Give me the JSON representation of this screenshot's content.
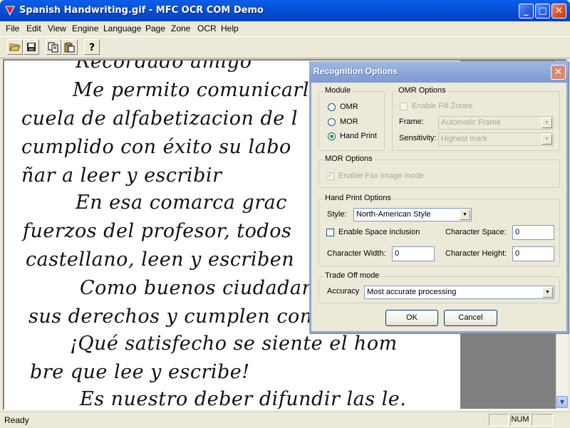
{
  "window": {
    "title": "Spanish Handwriting.gif - MFC OCR COM Demo",
    "minimize": "_",
    "maximize": "□",
    "close": "✕"
  },
  "menu": [
    "File",
    "Edit",
    "View",
    "Engine",
    "Language",
    "Page",
    "Zone",
    "OCR",
    "Help"
  ],
  "toolbar": {
    "icons": [
      "open-folder-icon",
      "save-icon",
      "copy-icon",
      "paste-icon",
      "help-icon"
    ]
  },
  "document": {
    "lines": [
      "Recordado amigo",
      "Me permito comunicarl",
      "cuela de alfabetizacion de l",
      "cumplido con éxito su labo",
      "ñar a leer y escribir",
      "En esa comarca grac",
      "fuerzos del profesor, todos",
      "castellano, leen y escriben",
      "Como buenos ciudadar",
      "sus derechos y cumplen con",
      "¡Qué satisfecho se siente el hom",
      "bre que lee y escribe!",
      "Es nuestro deber difundir las le."
    ]
  },
  "status": {
    "text": "Ready",
    "panes": [
      "",
      "NUM",
      ""
    ]
  },
  "dialog": {
    "title": "Recognition Options",
    "close": "✕",
    "module": {
      "label": "Module",
      "options": [
        "OMR",
        "MOR",
        "Hand Print"
      ],
      "selected": "Hand Print"
    },
    "omr": {
      "label": "OMR Options",
      "fill_zones_label": "Enable Fill Zones",
      "frame_label": "Frame:",
      "frame_value": "Automatic Frame",
      "sensitivity_label": "Sensitivity:",
      "sensitivity_value": "Highest mark"
    },
    "mor": {
      "label": "MOR Options",
      "fax_label": "Enable Fax Image mode"
    },
    "handprint": {
      "label": "Hand Print Options",
      "style_label": "Style:",
      "style_value": "North-American Style",
      "space_inclusion_label": "Enable Space inclusion",
      "char_space_label": "Character Space:",
      "char_space_value": "0",
      "char_width_label": "Character Width:",
      "char_width_value": "0",
      "char_height_label": "Character Height:",
      "char_height_value": "0"
    },
    "tradeoff": {
      "label": "Trade Off mode",
      "accuracy_label": "Accuracy",
      "accuracy_value": "Most accurate processing"
    },
    "ok": "OK",
    "cancel": "Cancel"
  }
}
